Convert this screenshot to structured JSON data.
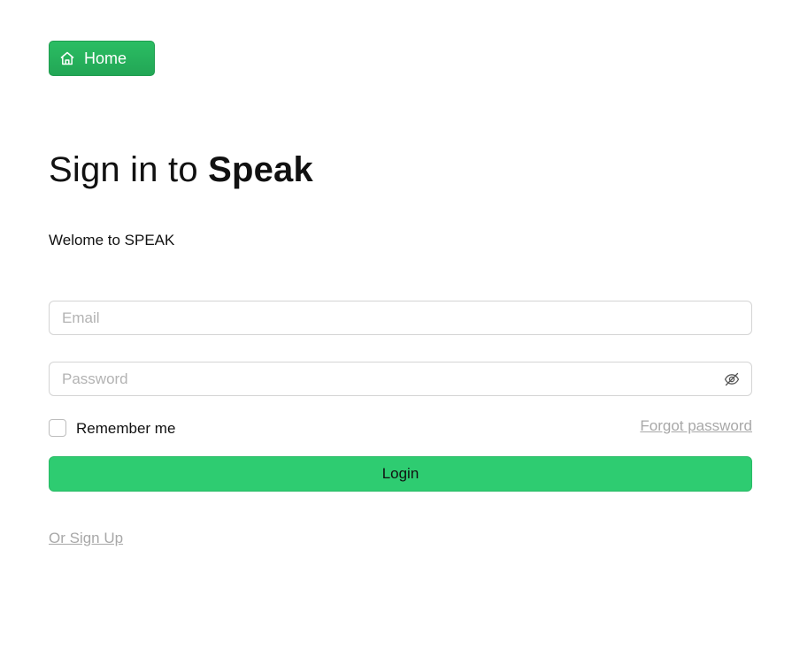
{
  "home_button": {
    "label": "Home",
    "icon": "home-icon"
  },
  "heading": {
    "prefix": "Sign in to ",
    "brand": "Speak"
  },
  "welcome_text": "Welome to SPEAK",
  "form": {
    "email": {
      "placeholder": "Email",
      "value": ""
    },
    "password": {
      "placeholder": "Password",
      "value": "",
      "toggle_icon": "eye-off-icon"
    },
    "remember_me": {
      "label": "Remember me",
      "checked": false
    },
    "forgot_password_label": "Forgot password",
    "login_label": "Login"
  },
  "signup_link_label": "Or Sign Up",
  "colors": {
    "primary_green": "#2ecc71",
    "home_green": "#27ae60",
    "muted_link": "#a8a8a8",
    "border": "#d4d4d4"
  }
}
